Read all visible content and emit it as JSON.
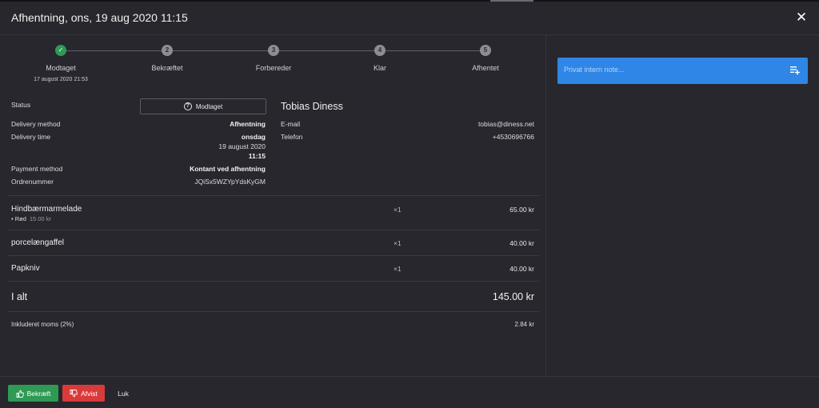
{
  "header": {
    "title": "Afhentning, ons, 19 aug 2020 11:15"
  },
  "stepper": [
    {
      "num": "",
      "label": "Modtaget",
      "sub": "17 august 2020 21:53",
      "done": true
    },
    {
      "num": "2",
      "label": "Bekræftet",
      "sub": "",
      "done": false
    },
    {
      "num": "3",
      "label": "Forbereder",
      "sub": "",
      "done": false
    },
    {
      "num": "4",
      "label": "Klar",
      "sub": "",
      "done": false
    },
    {
      "num": "5",
      "label": "Afhentet",
      "sub": "",
      "done": false
    }
  ],
  "order": {
    "status_label": "Status",
    "status_value": "Modtaget",
    "delivery_method_label": "Delivery method",
    "delivery_method_value": "Afhentning",
    "delivery_time_label": "Delivery time",
    "delivery_time_day": "onsdag",
    "delivery_time_date": "19 august 2020",
    "delivery_time_clock": "11:15",
    "payment_method_label": "Payment method",
    "payment_method_value": "Kontant ved afhentning",
    "order_number_label": "Ordrenummer",
    "order_number_value": "JQiSx5WZYpYdsKyGM"
  },
  "customer": {
    "name": "Tobias Diness",
    "email_label": "E-mail",
    "email_value": "tobias@diness.net",
    "phone_label": "Telefon",
    "phone_value": "+4530696766"
  },
  "lines": [
    {
      "name": "Hindbærmarmelade",
      "option": "• Rød",
      "option_price": "15.00 kr",
      "qty": "×1",
      "price": "65.00 kr"
    },
    {
      "name": "porcelængaffel",
      "option": "",
      "option_price": "",
      "qty": "×1",
      "price": "40.00 kr"
    },
    {
      "name": "Papkniv",
      "option": "",
      "option_price": "",
      "qty": "×1",
      "price": "40.00 kr"
    }
  ],
  "totals": {
    "total_label": "I alt",
    "total_value": "145.00 kr",
    "vat_label": "Inkluderet moms (2%)",
    "vat_value": "2.84 kr"
  },
  "note": {
    "placeholder": "Privat intern note..."
  },
  "footer": {
    "confirm_label": "Bekræft",
    "reject_label": "Afvist",
    "close_label": "Luk"
  },
  "colors": {
    "accent": "#2f86e6",
    "success": "#2f9a53",
    "danger": "#d93a3a",
    "background": "#27272d"
  }
}
